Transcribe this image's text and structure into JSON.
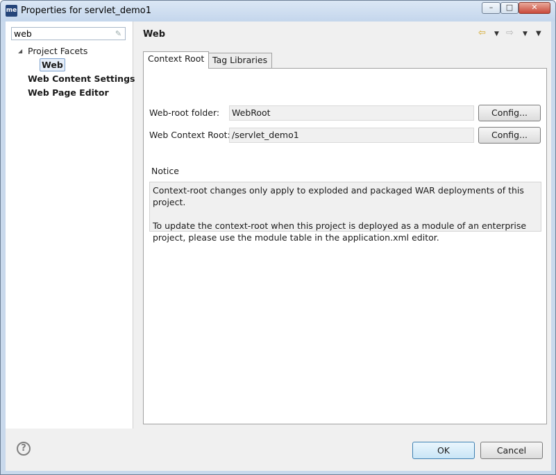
{
  "window": {
    "app_icon": "me",
    "title": "Properties for servlet_demo1",
    "min_glyph": "–",
    "max_glyph": "□",
    "close_glyph": "✕"
  },
  "filter": {
    "value": "web"
  },
  "tree": {
    "project_facets": "Project Facets",
    "web": "Web",
    "web_content_settings": "Web Content Settings",
    "web_page_editor": "Web Page Editor"
  },
  "page": {
    "title": "Web"
  },
  "nav": {
    "back": "⇦",
    "forward": "⇨",
    "dropdown": "▼",
    "menu": "▼"
  },
  "tabs": {
    "context_root": "Context Root",
    "tag_libraries": "Tag Libraries"
  },
  "form": {
    "web_root_label": "Web-root folder:",
    "web_root_value": "WebRoot",
    "context_root_label": "Web Context Root:",
    "context_root_value": "/servlet_demo1",
    "config_label": "Config..."
  },
  "notice": {
    "title": "Notice",
    "line1": "Context-root changes only apply to exploded and packaged WAR deployments of this project.",
    "line2": "To update the context-root when this project is deployed as a module of an enterprise project, please use the module table in the application.xml editor."
  },
  "footer": {
    "help": "?",
    "ok": "OK",
    "cancel": "Cancel"
  },
  "icons": {
    "clear_filter": "clear-filter-icon",
    "twisty": "expanded-arrow-icon",
    "back": "back-arrow-icon",
    "forward": "forward-arrow-icon",
    "help": "help-icon"
  }
}
